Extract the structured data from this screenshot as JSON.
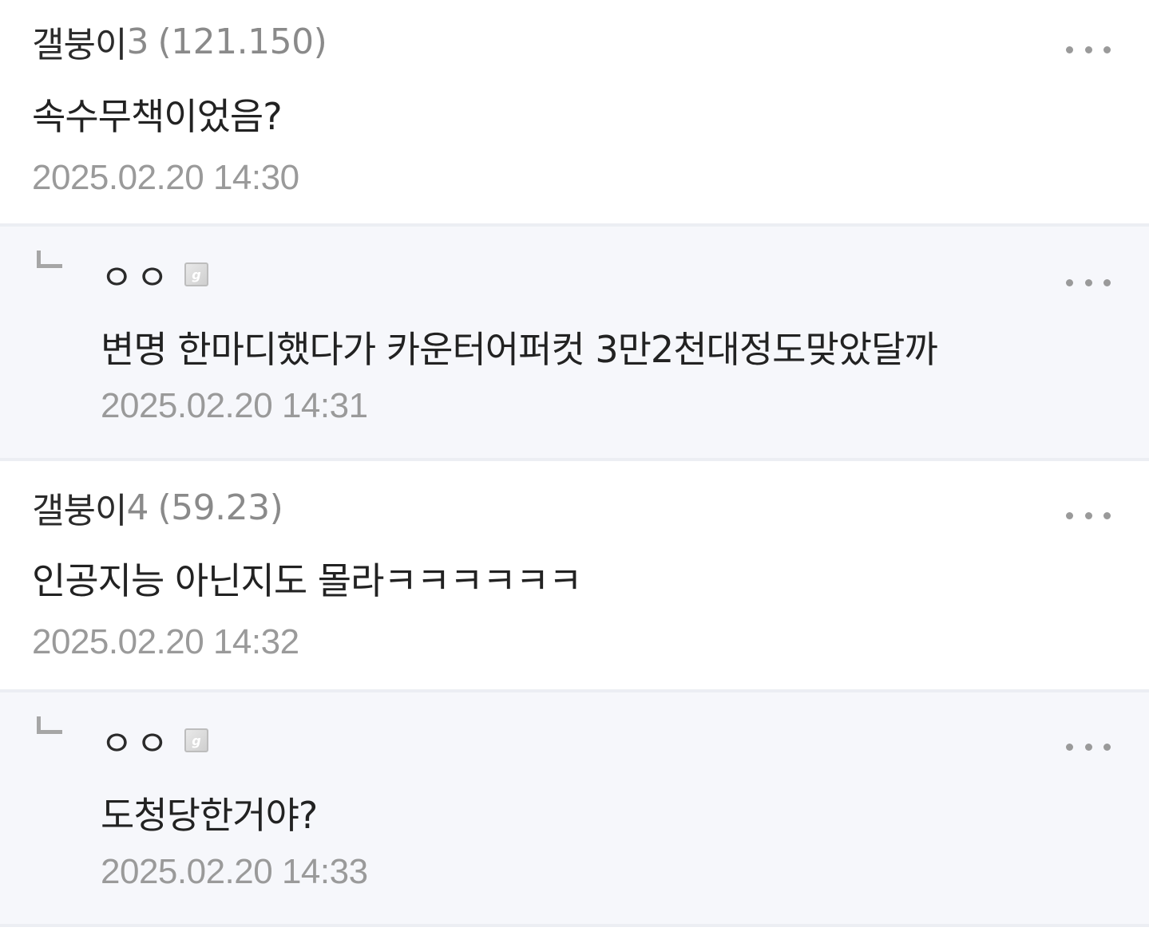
{
  "comments": [
    {
      "type": "comment",
      "author": "갤붕이",
      "author_num": "3",
      "ip": "(121.150)",
      "text": "속수무책이었음?",
      "timestamp": "2025.02.20 14:30"
    },
    {
      "type": "reply",
      "author": "ㅇㅇ",
      "badge_icon": "fixed-nick-badge-icon",
      "text": "변명 한마디했다가 카운터어퍼컷 3만2천대정도맞았달까",
      "timestamp": "2025.02.20 14:31"
    },
    {
      "type": "comment",
      "author": "갤붕이",
      "author_num": "4",
      "ip": "(59.23)",
      "text": "인공지능 아닌지도 몰라ㅋㅋㅋㅋㅋㅋ",
      "timestamp": "2025.02.20 14:32"
    },
    {
      "type": "reply",
      "author": "ㅇㅇ",
      "badge_icon": "fixed-nick-badge-icon",
      "text": "도청당한거야?",
      "timestamp": "2025.02.20 14:33"
    }
  ],
  "icons": {
    "more": "more-options-icon",
    "reply": "reply-arrow-icon"
  },
  "colors": {
    "reply_background": "#f6f7fb",
    "divider": "#eceef3",
    "meta_text": "#9a9a9a"
  }
}
